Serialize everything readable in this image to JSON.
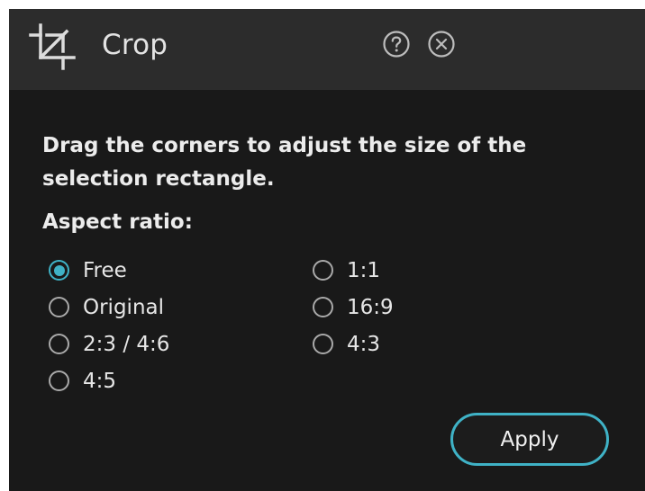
{
  "header": {
    "title": "Crop",
    "icon": "crop-icon",
    "help_icon": "help-icon",
    "close_icon": "close-icon"
  },
  "content": {
    "description": "Drag the corners to adjust the size of the selection rectangle.",
    "aspect_label": "Aspect ratio:"
  },
  "aspect_options": {
    "left": [
      {
        "label": "Free",
        "checked": true
      },
      {
        "label": "Original",
        "checked": false
      },
      {
        "label": "2:3 / 4:6",
        "checked": false
      },
      {
        "label": "4:5",
        "checked": false
      }
    ],
    "right": [
      {
        "label": "1:1",
        "checked": false
      },
      {
        "label": "16:9",
        "checked": false
      },
      {
        "label": "4:3",
        "checked": false
      }
    ]
  },
  "apply_label": "Apply",
  "colors": {
    "accent": "#3fb2c6",
    "panel_background": "#191919",
    "header_background": "#2c2c2c",
    "text": "#ececec"
  }
}
